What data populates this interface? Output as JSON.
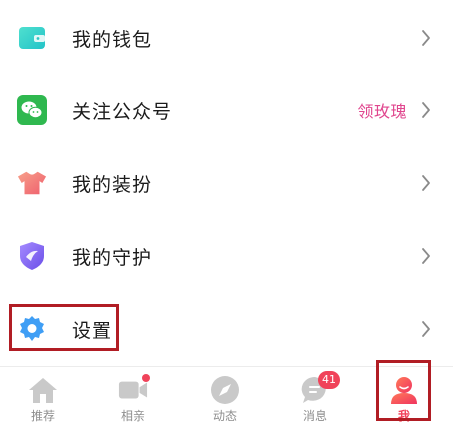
{
  "menu": {
    "items": [
      {
        "label": "我的钱包",
        "icon": "wallet-icon"
      },
      {
        "label": "关注公众号",
        "icon": "wechat-icon",
        "extra": "领玫瑰"
      },
      {
        "label": "我的装扮",
        "icon": "tshirt-icon"
      },
      {
        "label": "我的守护",
        "icon": "shield-icon"
      },
      {
        "label": "设置",
        "icon": "gear-icon"
      }
    ]
  },
  "tabbar": {
    "tabs": [
      {
        "label": "推荐",
        "icon": "home-icon"
      },
      {
        "label": "相亲",
        "icon": "video-camera-icon",
        "dot": true
      },
      {
        "label": "动态",
        "icon": "compass-icon"
      },
      {
        "label": "消息",
        "icon": "chat-bubble-icon",
        "badge": "41"
      },
      {
        "label": "我",
        "icon": "user-icon",
        "active": true
      }
    ]
  },
  "colors": {
    "accent": "#f2415a",
    "highlight_box": "#b11d24",
    "extra_text": "#e0468e",
    "wallet": "#35d4c4",
    "wechat": "#2fb84f",
    "tshirt": "#f27a6e",
    "shield": "#8b5cf6",
    "gear": "#3f9ef5"
  }
}
